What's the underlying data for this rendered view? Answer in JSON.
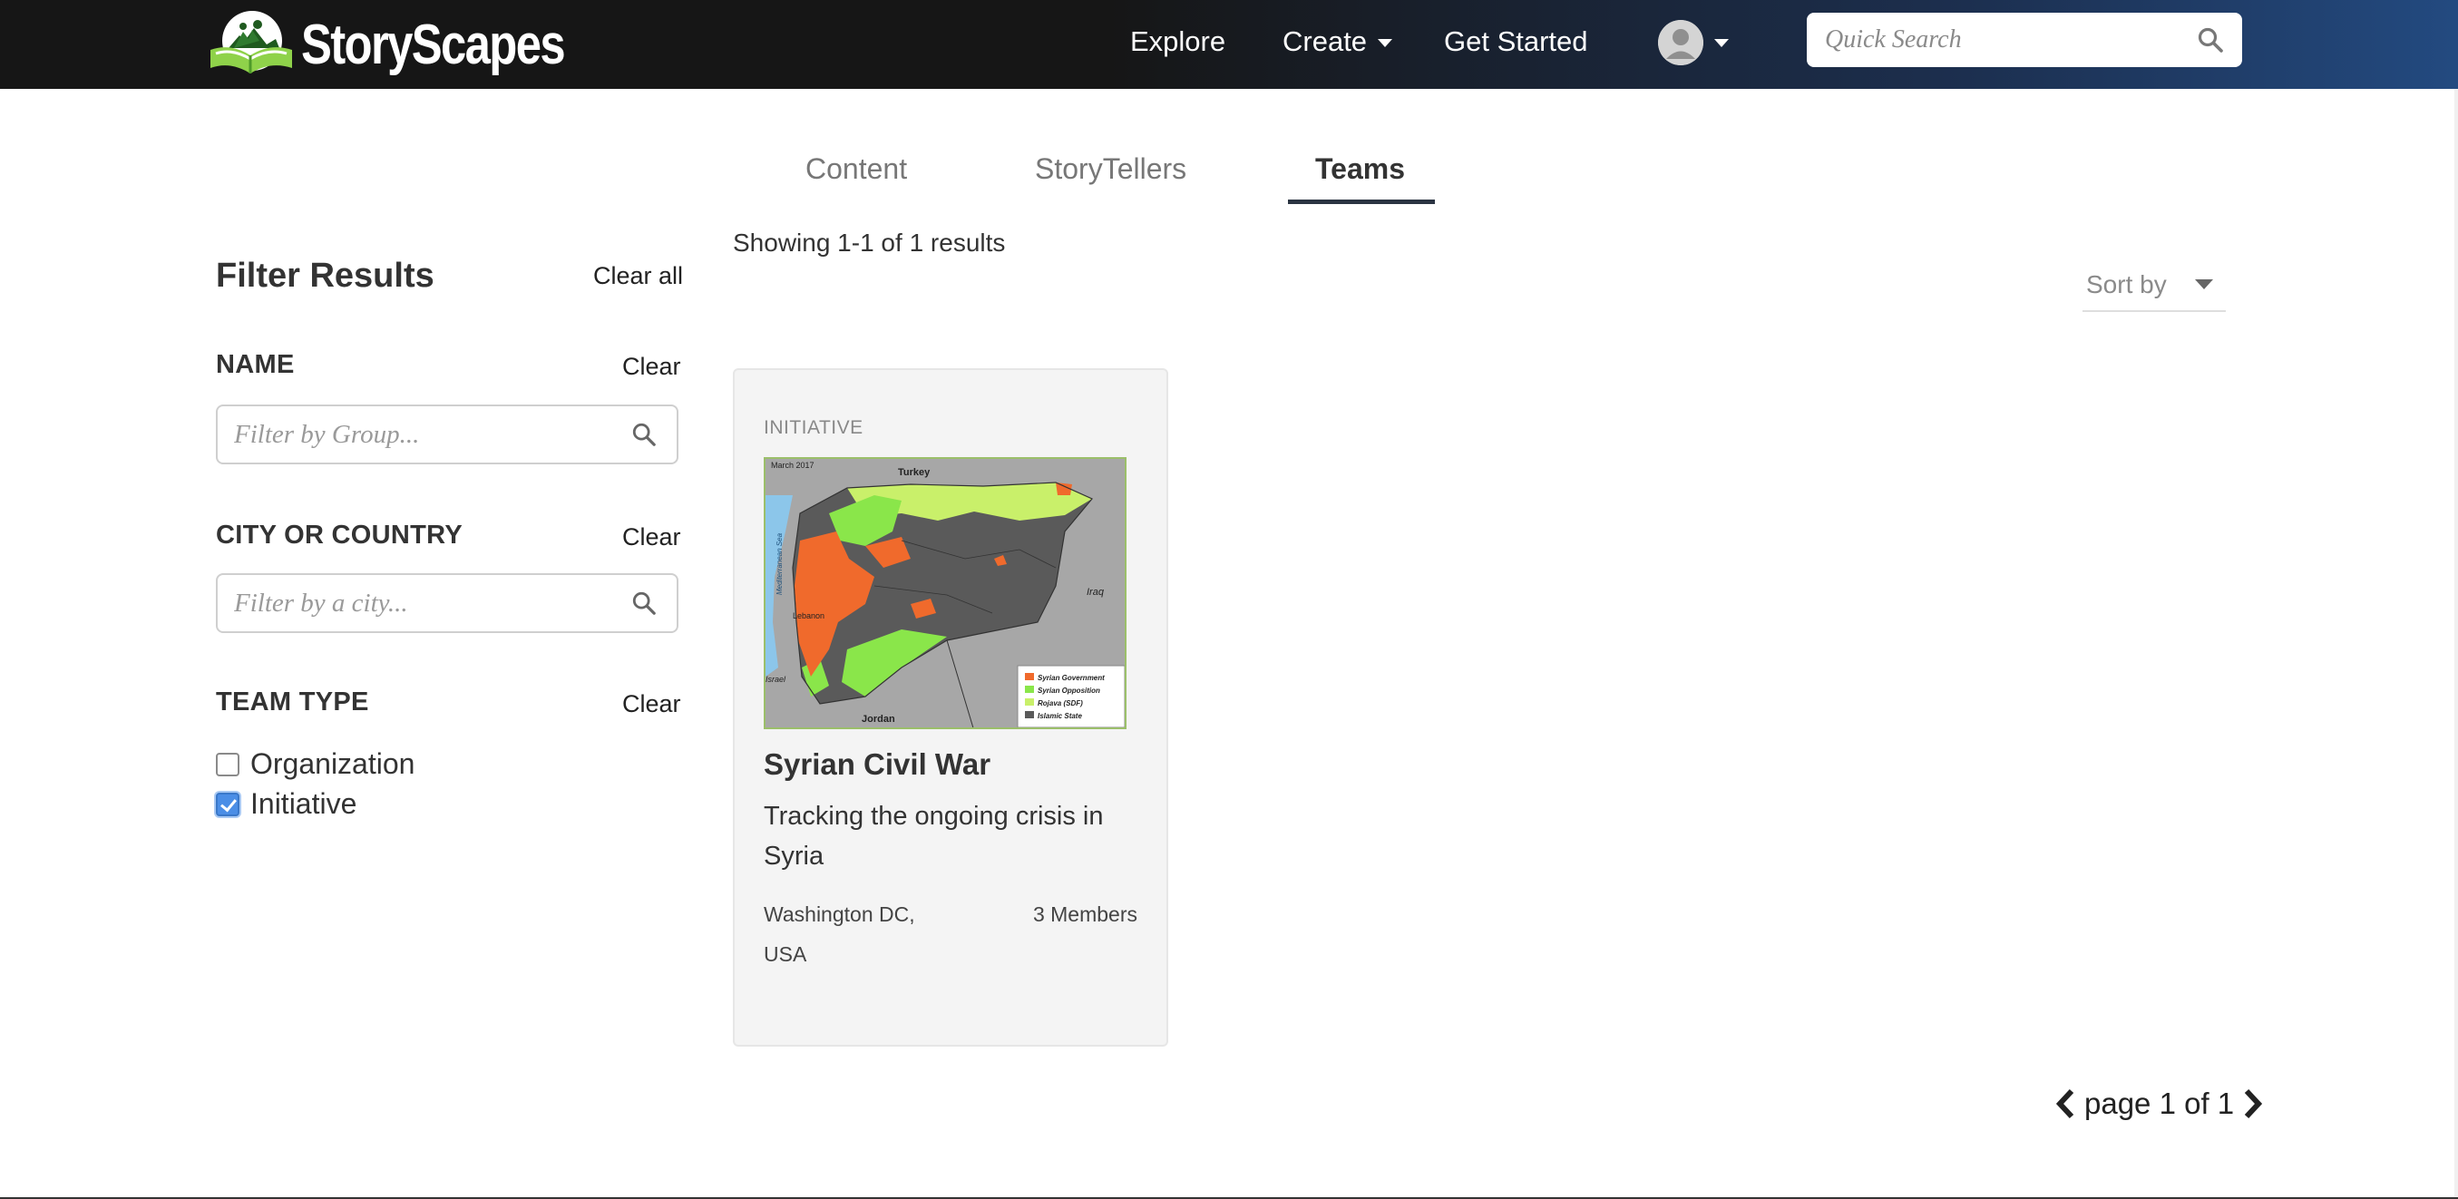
{
  "navbar": {
    "brand_name": "StoryScapes",
    "links": {
      "explore": "Explore",
      "create": "Create",
      "get_started": "Get Started"
    },
    "search_placeholder": "Quick Search"
  },
  "tabs": [
    {
      "label": "Content",
      "active": false
    },
    {
      "label": "StoryTellers",
      "active": false
    },
    {
      "label": "Teams",
      "active": true
    }
  ],
  "sidebar": {
    "title": "Filter Results",
    "clear_all": "Clear all",
    "name_section": {
      "label": "NAME",
      "clear": "Clear",
      "placeholder": "Filter by Group..."
    },
    "city_section": {
      "label": "CITY OR COUNTRY",
      "clear": "Clear",
      "placeholder": "Filter by a city..."
    },
    "team_type_section": {
      "label": "TEAM TYPE",
      "clear": "Clear",
      "options": [
        {
          "label": "Organization",
          "checked": false
        },
        {
          "label": "Initiative",
          "checked": true
        }
      ]
    }
  },
  "results": {
    "count_text": "Showing 1-1 of 1 results",
    "sort_label": "Sort by",
    "cards": [
      {
        "type": "INITIATIVE",
        "title": "Syrian Civil War",
        "description": "Tracking the ongoing crisis in Syria",
        "location": "Washington DC, USA",
        "members": "3 Members",
        "map_labels": {
          "date": "March 2017",
          "turkey": "Turkey",
          "iraq": "Iraq",
          "jordan": "Jordan",
          "lebanon": "Lebanon",
          "israel": "Israel",
          "sea": "Mediterranean Sea",
          "legend": [
            "Syrian Government",
            "Syrian Opposition",
            "Rojava (SDF)",
            "Islamic State"
          ]
        }
      }
    ]
  },
  "pagination": {
    "text": "page 1 of 1"
  },
  "colors": {
    "navbar_dark": "#161616",
    "navbar_blue": "#234a80",
    "tab_underline": "#2b3442",
    "checkbox_checked": "#4b8ee6",
    "map_government": "#f06a2c",
    "map_opposition": "#8ae64a",
    "map_rojava": "#c9f06a",
    "map_islamic_state": "#5a5a5a"
  }
}
